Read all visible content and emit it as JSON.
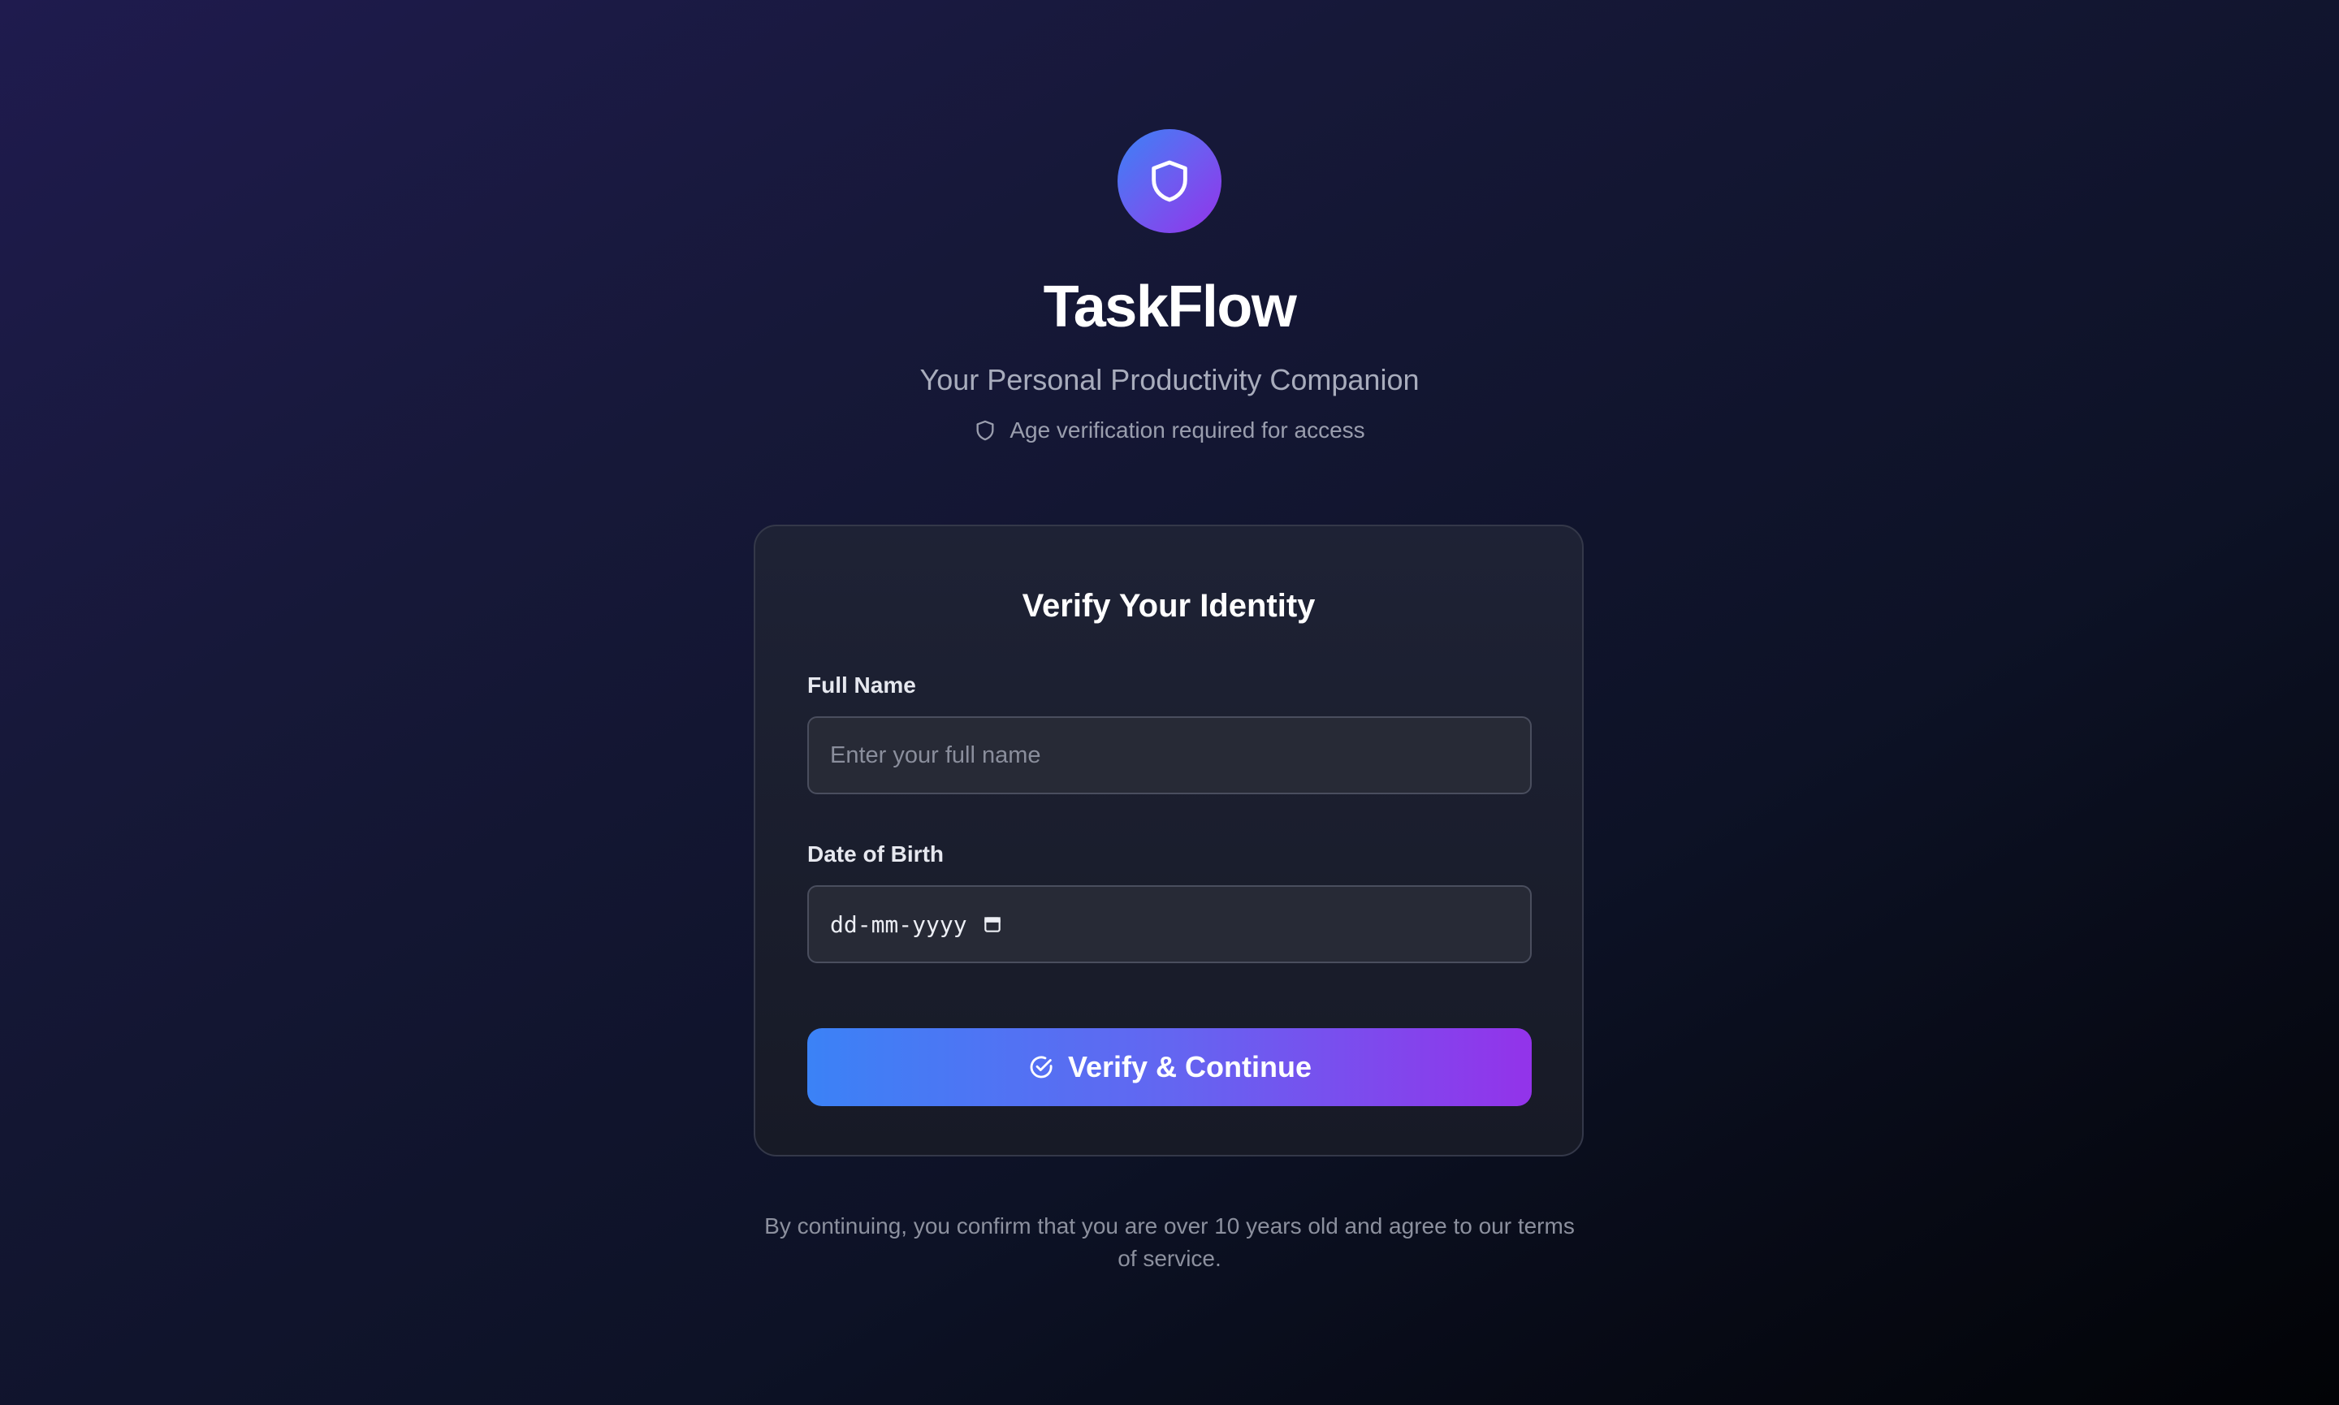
{
  "header": {
    "app_name": "TaskFlow",
    "tagline": "Your Personal Productivity Companion",
    "notice": "Age verification required for access",
    "logo_icon": "shield-icon",
    "notice_icon": "shield-icon"
  },
  "card": {
    "title": "Verify Your Identity",
    "full_name": {
      "label": "Full Name",
      "value": "",
      "placeholder": "Enter your full name"
    },
    "dob": {
      "label": "Date of Birth",
      "value": "dd-mm-yyyy",
      "icon": "calendar-icon"
    },
    "submit": {
      "label": "Verify & Continue",
      "icon": "check-circle-icon"
    }
  },
  "footer": {
    "note": "By continuing, you confirm that you are over 10 years old and agree to our terms of service."
  },
  "colors": {
    "accent_start": "#3b82f6",
    "accent_end": "#9333ea",
    "background": "#161838",
    "card": "#1e2235"
  }
}
